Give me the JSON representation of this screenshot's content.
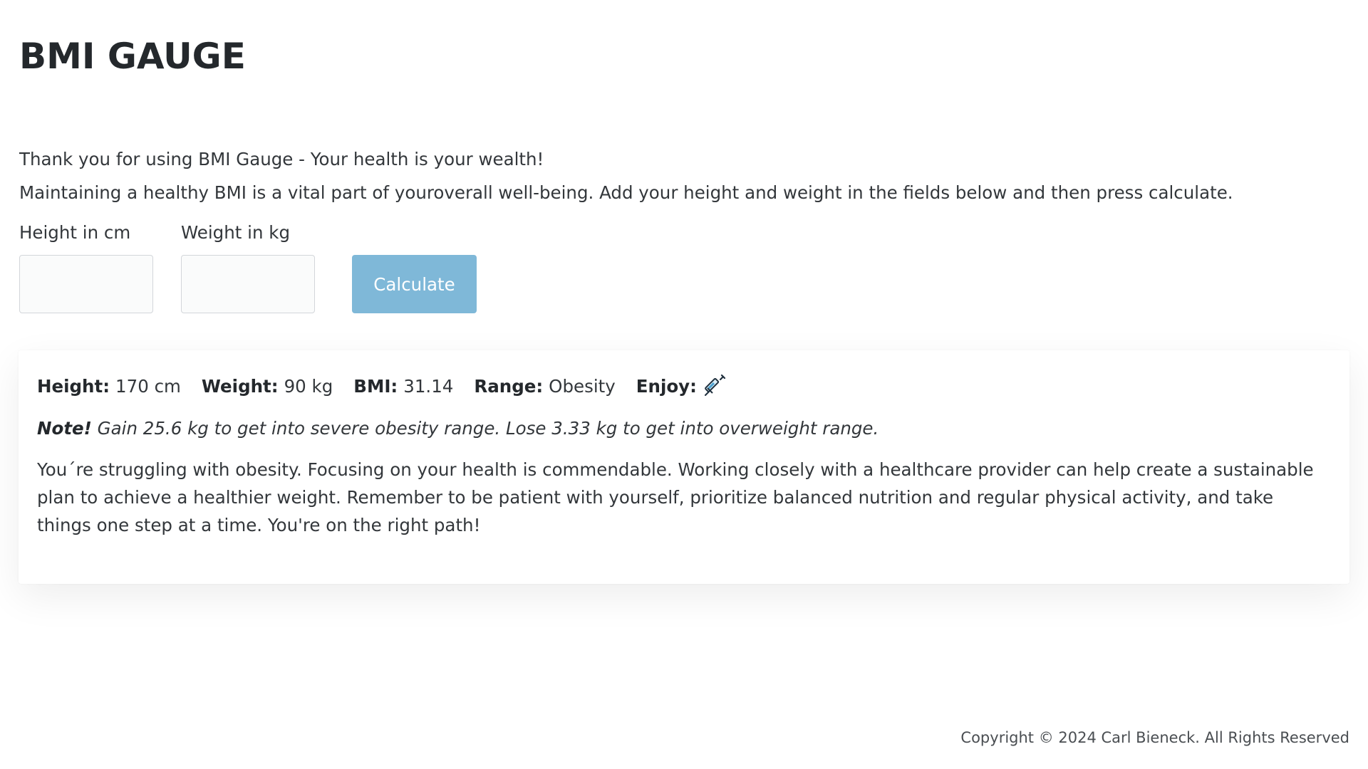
{
  "header": {
    "title": "BMI GAUGE"
  },
  "intro": {
    "line1": "Thank you for using BMI Gauge - Your health is your wealth!",
    "line2": "Maintaining a healthy BMI is a vital part of youroverall well-being. Add your height and weight in the fields below and then press calculate."
  },
  "form": {
    "height_label": "Height in cm",
    "height_value": "",
    "weight_label": "Weight in kg",
    "weight_value": "",
    "calculate_label": "Calculate"
  },
  "result": {
    "height_label": "Height:",
    "height_value": "170 cm",
    "weight_label": "Weight:",
    "weight_value": "90 kg",
    "bmi_label": "BMI:",
    "bmi_value": "31.14",
    "range_label": "Range:",
    "range_value": "Obesity",
    "enjoy_label": "Enjoy:",
    "enjoy_icon": "syringe-icon",
    "note_label": "Note!",
    "note_text": "Gain 25.6 kg to get into severe obesity range. Lose 3.33 kg to get into overweight range.",
    "message": "You´re struggling with obesity. Focusing on your health is commendable. Working closely with a healthcare provider can help create a sustainable plan to achieve a healthier weight. Remember to be patient with yourself, prioritize balanced nutrition and regular physical activity, and take things one step at a time. You're on the right path!"
  },
  "footer": {
    "copyright": "Copyright © 2024 Carl Bieneck. All Rights Reserved"
  },
  "colors": {
    "button_bg": "#7fb8d8",
    "text": "#33373b",
    "heading": "#24282c"
  }
}
